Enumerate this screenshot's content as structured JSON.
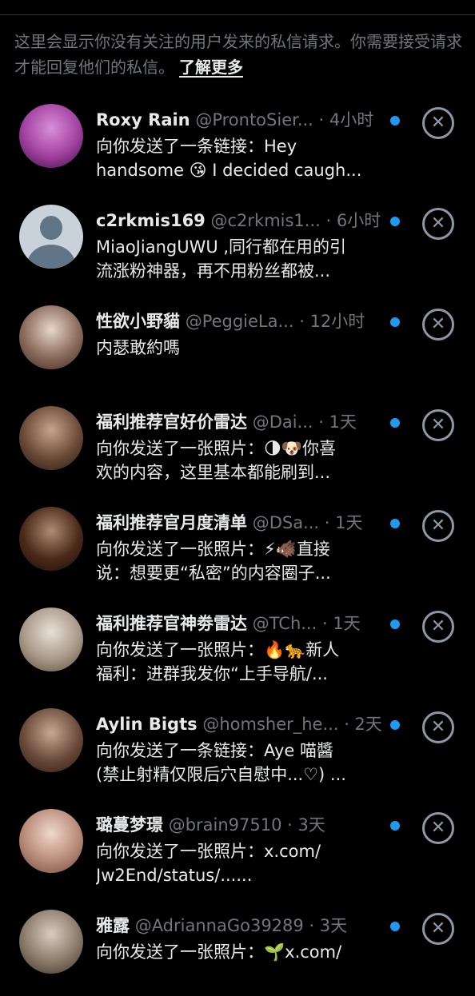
{
  "colors": {
    "background": "#000000",
    "text_primary": "#e7e9ea",
    "text_secondary": "#71767b",
    "unread_dot": "#1d9bf0",
    "close_icon": "#8b98a5"
  },
  "notice": {
    "text": "这里会显示你没有关注的用户发来的私信请求。你需要接受请求才能回复他们的私信。",
    "learn_more": "了解更多"
  },
  "requests": [
    {
      "name": "Roxy Rain",
      "handle": "@ProntoSier...",
      "time": "4小时",
      "line1": "向你发送了一条链接：Hey",
      "line2": "handsome 😘 I decided caugh...",
      "avatar_colors": [
        "#d98fd9",
        "#a040a0",
        "#3a1040"
      ]
    },
    {
      "name": "c2rkmis169",
      "handle": "@c2rkmis1...",
      "time": "6小时",
      "line1": "MiaoJiangUWU ,同行都在用的引",
      "line2": "流涨粉神器，再不用粉丝都被...",
      "avatar_colors": [
        "#c9d2da",
        "#627586",
        "#627586"
      ]
    },
    {
      "name": "性欲小野貓",
      "handle": "@PeggieLa...",
      "time": "12小时",
      "line1": "内瑟敢約嗎",
      "line2": "",
      "avatar_colors": [
        "#e8d6cc",
        "#8a6a5a",
        "#3a2a22"
      ]
    },
    {
      "name": "福利推荐官好价雷达",
      "handle": "@Dai...",
      "time": "1天",
      "line1": "向你发送了一张照片：🌗🐶你喜",
      "line2": "欢的内容，这里基本都能刷到...",
      "avatar_colors": [
        "#c9a48a",
        "#6b4a38",
        "#2a1a12"
      ]
    },
    {
      "name": "福利推荐官月度清单",
      "handle": "@DSa...",
      "time": "1天",
      "line1": "向你发送了一张照片：⚡🐗直接",
      "line2": "说：想要更“私密”的内容圈子...",
      "avatar_colors": [
        "#b08a70",
        "#4a2a1a",
        "#1a0d08"
      ]
    },
    {
      "name": "福利推荐官神劵雷达",
      "handle": "@TCh...",
      "time": "1天",
      "line1": "向你发送了一张照片：🔥🐆新人",
      "line2": "福利：进群我发你“上手导航/...",
      "avatar_colors": [
        "#e8e0d8",
        "#a89888",
        "#5a4a3a"
      ]
    },
    {
      "name": "Aylin Bigts",
      "handle": "@homsher_he...",
      "time": "2天",
      "line1": "向你发送了一条链接：Aye 喵醬",
      "line2": "(禁止射精仅限后穴自慰中...♡) ...",
      "avatar_colors": [
        "#c8a890",
        "#6a4a3a",
        "#2a1a12"
      ]
    },
    {
      "name": "璐蔓梦璟",
      "handle": "@brain97510",
      "time": "3天",
      "line1": "向你发送了一张照片：x.com/",
      "line2": "Jw2End/status/......",
      "avatar_colors": [
        "#f0d8cc",
        "#b88a78",
        "#6a4a3a"
      ]
    },
    {
      "name": "雅露",
      "handle": "@AdriannaGo39289",
      "time": "3天",
      "line1": "向你发送了一张照片：🌱x.com/",
      "line2": "",
      "avatar_colors": [
        "#d8ccc0",
        "#8a7a6a",
        "#3a3028"
      ]
    }
  ],
  "icons": {
    "close": "✕",
    "unread": "unread-dot"
  }
}
